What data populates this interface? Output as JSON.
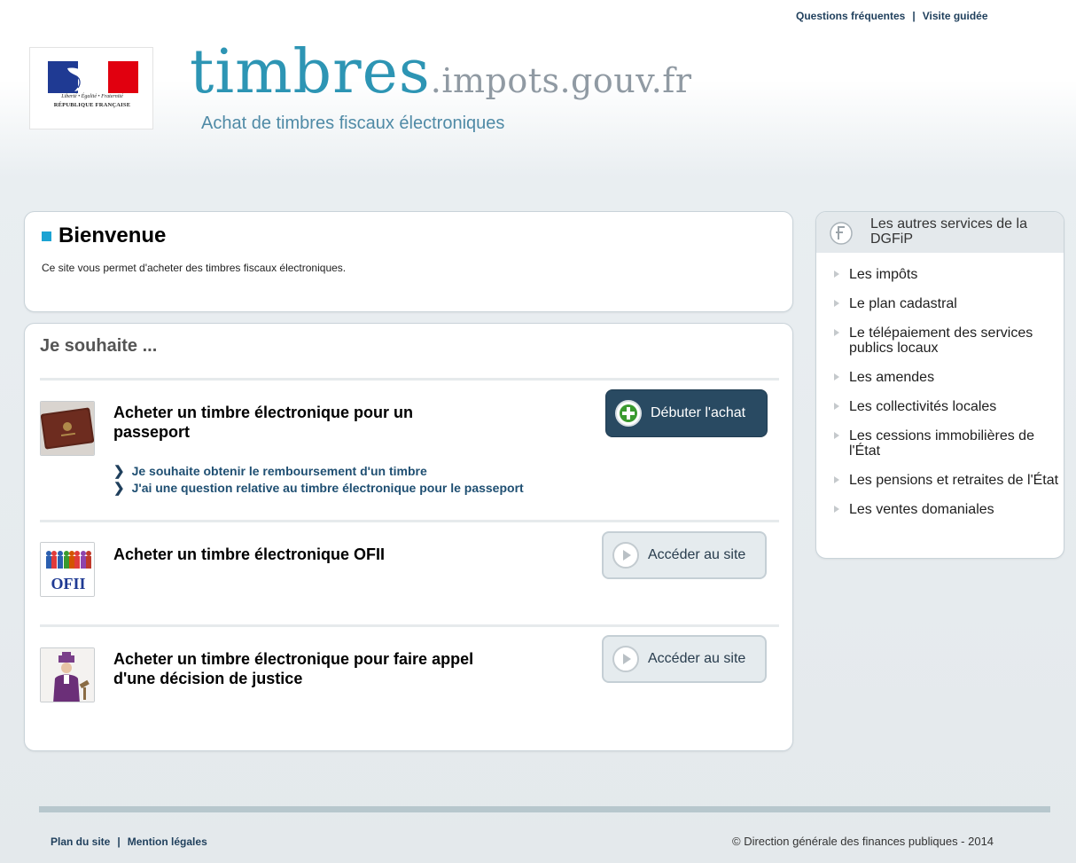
{
  "top_links": {
    "faq": "Questions fréquentes",
    "separator": "|",
    "tour": "Visite guidée"
  },
  "logo": {
    "motto": "Liberté • Égalité • Fraternité",
    "republic": "RÉPUBLIQUE FRANÇAISE"
  },
  "header": {
    "title_main": "timbres",
    "title_domain": ".impots.gouv.fr",
    "subtitle": "Achat de timbres fiscaux électroniques"
  },
  "welcome": {
    "title": "Bienvenue",
    "text": "Ce site vous permet d'acheter des timbres fiscaux électroniques."
  },
  "wish": {
    "title": "Je souhaite ...",
    "items": [
      {
        "icon": "passport-icon",
        "title_line1": "Acheter un timbre électronique pour un",
        "title_line2": "passeport",
        "button": "Débuter l'achat",
        "links": [
          "Je souhaite obtenir le remboursement d'un timbre",
          "J'ai une question relative au timbre électronique pour le passeport"
        ]
      },
      {
        "icon": "ofii-icon",
        "icon_text": "OFII",
        "title_line1": "Acheter un timbre électronique OFII",
        "button": "Accéder au site"
      },
      {
        "icon": "justice-icon",
        "title_line1": "Acheter un timbre électronique pour faire appel",
        "title_line2": "d'une décision de justice",
        "button": "Accéder au site"
      }
    ]
  },
  "sidebar": {
    "title": "Les autres services de la DGFiP",
    "items": [
      "Les impôts",
      "Le plan cadastral",
      "Le télépaiement des services publics locaux",
      "Les amendes",
      "Les collectivités locales",
      "Les cessions immobilières de l'État",
      "Les pensions et retraites de l'État",
      "Les ventes domaniales"
    ]
  },
  "footer": {
    "sitemap": "Plan du site",
    "separator": "|",
    "legal": "Mention légales",
    "copyright": "© Direction générale des finances publiques - 2014"
  },
  "colors": {
    "accent": "#2d95b4",
    "primary_button": "#294a62",
    "link": "#1f4f72"
  }
}
